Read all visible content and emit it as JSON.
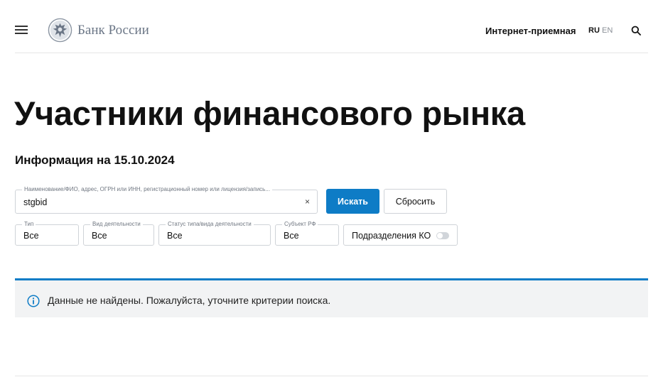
{
  "header": {
    "brand": "Банк России",
    "reception": "Интернет-приемная",
    "lang_active": "RU",
    "lang_other": "EN"
  },
  "page": {
    "title": "Участники финансового рынка",
    "subtitle": "Информация на 15.10.2024"
  },
  "search": {
    "legend": "Наименование/ФИО, адрес, ОГРН или ИНН, регистрационный номер или лицензия/запись...",
    "value": "stgbid",
    "clear": "×",
    "submit_label": "Искать",
    "reset_label": "Сбросить"
  },
  "filters": {
    "type": {
      "legend": "Тип",
      "value": "Все"
    },
    "activity": {
      "legend": "Вид деятельности",
      "value": "Все"
    },
    "status": {
      "legend": "Статус типа/вида деятельности",
      "value": "Все"
    },
    "region": {
      "legend": "Субъект РФ",
      "value": "Все"
    },
    "branches": {
      "label": "Подразделения КО",
      "enabled": false
    }
  },
  "alert": {
    "message": "Данные не найдены. Пожалуйста, уточните критерии поиска."
  },
  "colors": {
    "accent": "#0e7cc6",
    "alert_bg": "#f2f3f4",
    "brand_text": "#6b7686"
  },
  "icons": {
    "menu": "hamburger-menu-icon",
    "logo": "bank-emblem-icon",
    "search": "search-icon",
    "info": "info-icon"
  }
}
